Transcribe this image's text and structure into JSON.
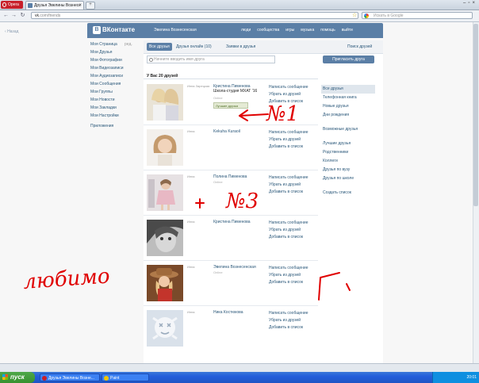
{
  "browser": {
    "opera_label": "Opera",
    "tab_title": "Друзья Эвелины Вознесе",
    "url_host": "vk",
    "url_path": ".com/friends",
    "search_placeholder": "Искать в Google"
  },
  "vk": {
    "logo_text": "ВКонтакте",
    "logo_mark": "В",
    "username": "Эвелина Вознесенская",
    "top_nav": [
      "люди",
      "сообщества",
      "игры",
      "музыка",
      "помощь",
      "выйти"
    ],
    "back_link": "Назад",
    "left_nav": [
      {
        "label": "Моя Страница",
        "edit": "ред."
      },
      {
        "label": "Мои Друзья"
      },
      {
        "label": "Мои Фотографии"
      },
      {
        "label": "Мои Видеозаписи"
      },
      {
        "label": "Мои Аудиозаписи"
      },
      {
        "label": "Мои Сообщения"
      },
      {
        "label": "Мои Группы"
      },
      {
        "label": "Мои Новости"
      },
      {
        "label": "Мои Закладки"
      },
      {
        "label": "Мои Настройки"
      },
      {
        "label": "Приложения"
      }
    ],
    "friend_tabs": [
      "Все друзья",
      "Друзья онлайн (10)",
      "Заявки в друзья",
      "Поиск друзей"
    ],
    "filter_placeholder": "Начните вводить имя друга",
    "invite_button": "Пригласить друга",
    "friends_count": "У Вас 20 друзей",
    "friends": [
      {
        "label": "Инна Зарецкая",
        "name": "Кристина Пименова",
        "sub": "Школа-студия МХАТ '16",
        "online": "Online",
        "best": "Лучшие друзья",
        "actions": [
          "Написать сообщение",
          "Убрать из друзей",
          "Добавить в список"
        ]
      },
      {
        "label": "Инна",
        "name": "Kekuha Kuraoil",
        "sub": "",
        "online": "",
        "actions": [
          "Написать сообщение",
          "Убрать из друзей",
          "Добавить в список"
        ]
      },
      {
        "label": "Инна",
        "name": "Полина Пименова",
        "sub": "",
        "online": "Online",
        "actions": [
          "Написать сообщение",
          "Убрать из друзей",
          "Добавить в список"
        ]
      },
      {
        "label": "Инна",
        "name": "Кристина Пименова",
        "sub": "",
        "online": "",
        "actions": [
          "Написать сообщение",
          "Убрать из друзей",
          "Добавить в список"
        ]
      },
      {
        "label": "Инна",
        "name": "Эвелина Вознесенская",
        "sub": "",
        "online": "Online",
        "actions": [
          "Написать сообщение",
          "Убрать из друзей",
          "Добавить в список"
        ]
      },
      {
        "label": "Инна",
        "name": "Ника Костюкова",
        "sub": "",
        "online": "",
        "actions": [
          "Написать сообщение",
          "Убрать из друзей",
          "Добавить в список"
        ]
      }
    ],
    "right_side": {
      "group1": [
        "Все друзья",
        "Телефонная книга",
        "Новые друзья",
        "Дни рождения"
      ],
      "group2": [
        "Возможные друзья"
      ],
      "group3": [
        "Лучшие друзья",
        "Родственники",
        "Коллеги",
        "Друзья по вузу",
        "Друзья по школе"
      ],
      "group4": [
        "Создать список"
      ]
    }
  },
  "annotations": {
    "n1": "№1",
    "n3": "№3",
    "n4": "№",
    "love": "любимо",
    "plus": "+"
  },
  "taskbar": {
    "start_label": "пуск",
    "tasks": [
      "Друзья Эвелины Возне...",
      "Paint"
    ],
    "clock": "20:01"
  },
  "colors": {
    "vk_blue": "#5b7fa6",
    "link": "#2b587a",
    "marker_red": "#e00000"
  }
}
